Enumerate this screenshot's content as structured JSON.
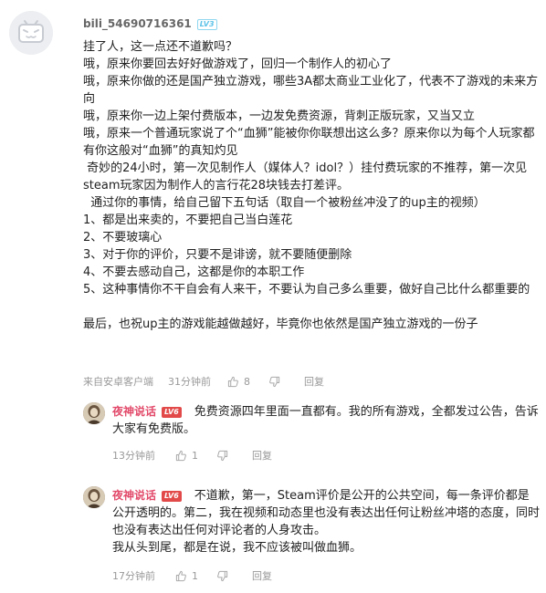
{
  "main_comment": {
    "username": "bili_54690716361",
    "level": "LV3",
    "paragraphs": [
      "挂了人，这一点还不道歉吗？",
      "哦，原来你要回去好好做游戏了，回归一个制作人的初心了",
      "哦，原来你做的还是国产独立游戏，哪些3A都太商业工业化了，代表不了游戏的未来方向",
      "哦，原来你一边上架付费版本，一边发免费资源，背刺正版玩家，又当又立",
      "哦，原来一个普通玩家说了个“血狮”能被你你联想出这么多？原来你以为每个人玩家都有你这般对“血狮”的真知灼见",
      " 奇妙的24小时，第一次见制作人（媒体人？idol？）挂付费玩家的不推荐，第一次见steam玩家因为制作人的言行花28块钱去打差评。",
      "  通过你的事情，给自己留下五句话（取自一个被粉丝冲没了的up主的视频）",
      "1、都是出来卖的，不要把自己当白莲花",
      "2、不要玻璃心",
      "3、对于你的评价，只要不是诽谤，就不要随便删除",
      "4、不要去感动自己，这都是你的本职工作",
      "5、这种事情你不干自会有人来干，不要认为自己多么重要，做好自己比什么都重要的",
      "",
      "最后，也祝up主的游戏能越做越好，毕竟你也依然是国产独立游戏的一份子"
    ],
    "source": "来自安卓客户端",
    "time": "31分钟前",
    "likes": "8",
    "reply_label": "回复"
  },
  "replies": [
    {
      "username": "夜神说话",
      "level": "LV6",
      "text": "免费资源四年里面一直都有。我的所有游戏，全都发过公告，告诉大家有免费版。",
      "time": "13分钟前",
      "likes": "1",
      "reply_label": "回复"
    },
    {
      "username": "夜神说话",
      "level": "LV6",
      "text": "不道歉，第一，Steam评价是公开的公共空间，每一条评价都是公开透明的。第二，我在视频和动态里也没有表达出任何让粉丝冲塔的态度，同时也没有表达出任何对评论者的人身攻击。\n我从头到尾，都是在说，我不应该被叫做血狮。",
      "time": "17分钟前",
      "likes": "1",
      "reply_label": "回复"
    }
  ],
  "icons": {
    "avatar_main": "tv-mascot-icon",
    "avatar_reply": "portrait-icon",
    "like": "thumb-up-icon",
    "dislike": "thumb-down-icon"
  }
}
